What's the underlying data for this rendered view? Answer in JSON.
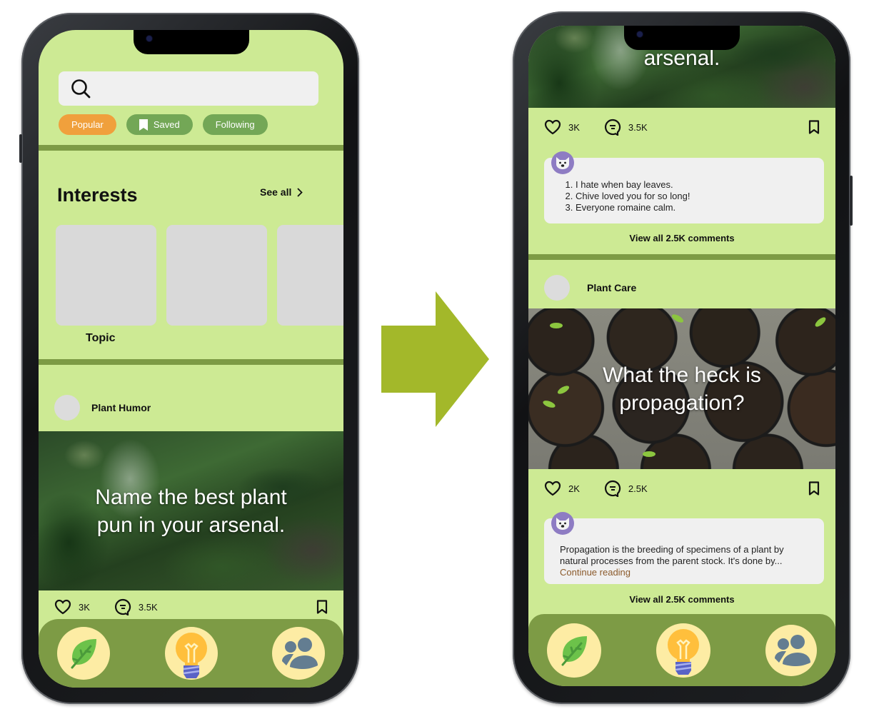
{
  "colors": {
    "screen_bg": "#cdea94",
    "divider": "#7d9b45",
    "nav_bg": "#7d9b45",
    "nav_button": "#fdeca4",
    "chip_popular": "#f0a03c",
    "chip_green": "#73a756",
    "arrow": "#a3b82a",
    "continue_link": "#8b5a2b"
  },
  "left_screen": {
    "search": {
      "icon": "search-icon",
      "placeholder": "",
      "value": ""
    },
    "filters": [
      {
        "label": "Popular",
        "active": true
      },
      {
        "label": "Saved",
        "icon": "bookmark-icon"
      },
      {
        "label": "Following"
      }
    ],
    "interests": {
      "title": "Interests",
      "see_all": "See all",
      "topics": [
        {
          "label": "Topic"
        },
        {
          "label": ""
        },
        {
          "label": ""
        }
      ]
    },
    "post": {
      "community": "Plant Humor",
      "headline": "Name the best plant pun in your arsenal.",
      "likes": "3K",
      "comments": "3.5K"
    }
  },
  "right_screen": {
    "post1": {
      "headline_partial": "arsenal.",
      "likes": "3K",
      "comments": "3.5K",
      "top_comment": [
        "I hate when bay leaves.",
        "Chive loved you for so long!",
        "Everyone romaine calm."
      ],
      "view_all": "View all 2.5K comments"
    },
    "post2": {
      "community": "Plant Care",
      "headline": "What the heck is propagation?",
      "likes": "2K",
      "comments": "2.5K",
      "top_comment": "Propagation is the breeding of specimens of a plant by natural processes from the parent stock. It's done by...",
      "continue_label": "Continue reading",
      "view_all": "View all 2.5K comments"
    }
  },
  "bottom_nav": [
    {
      "name": "leaf",
      "icon": "leaf-icon"
    },
    {
      "name": "ideas",
      "icon": "lightbulb-icon"
    },
    {
      "name": "community",
      "icon": "people-icon"
    }
  ]
}
